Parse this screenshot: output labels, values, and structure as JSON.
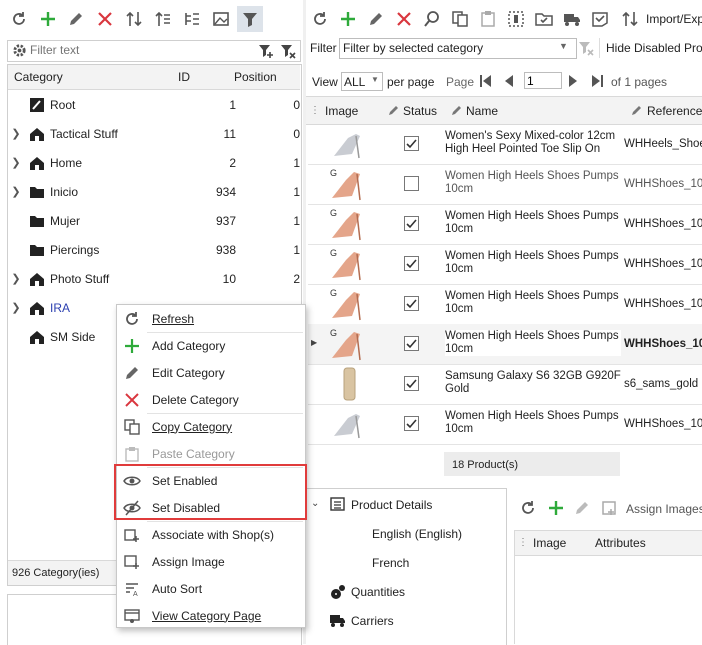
{
  "left_panel": {
    "filter_placeholder": "Filter text",
    "columns": {
      "category": "Category",
      "id": "ID",
      "position": "Position"
    },
    "tree": [
      {
        "label": "Root",
        "id": "1",
        "pos": "0"
      },
      {
        "label": "Tactical Stuff",
        "id": "11",
        "pos": "0"
      },
      {
        "label": "Home",
        "id": "2",
        "pos": "1"
      },
      {
        "label": "Inicio",
        "id": "934",
        "pos": "1"
      },
      {
        "label": "Mujer",
        "id": "937",
        "pos": "1"
      },
      {
        "label": "Piercings",
        "id": "938",
        "pos": "1"
      },
      {
        "label": "Photo Stuff",
        "id": "10",
        "pos": "2"
      },
      {
        "label": "IRA"
      },
      {
        "label": "SM Side"
      }
    ],
    "footer": "926 Category(ies)"
  },
  "right_panel": {
    "toolbar_import_label": "Import/Exp",
    "filter_label": "Filter",
    "filter_value": "Filter by selected category",
    "hide_disabled_label": "Hide Disabled Pro",
    "view_label": "View",
    "view_value": "ALL",
    "per_page_label": "per page",
    "page_label": "Page",
    "page_value": "1",
    "of_pages": "of 1 pages",
    "grid_columns": {
      "image": "Image",
      "status": "Status",
      "name": "Name",
      "reference": "Reference"
    },
    "rows": [
      {
        "name": "Women's Sexy Mixed-color 12cm High Heel Pointed Toe Slip On",
        "ref": "WHHeels_Shoe",
        "checked": true
      },
      {
        "name": "Women High Heels Shoes Pumps 10cm",
        "ref": "WHHShoes_10",
        "checked": false
      },
      {
        "name": "Women High Heels Shoes Pumps 10cm",
        "ref": "WHHShoes_10",
        "checked": true
      },
      {
        "name": "Women High Heels Shoes Pumps 10cm",
        "ref": "WHHShoes_10",
        "checked": true
      },
      {
        "name": "Women High Heels Shoes Pumps 10cm",
        "ref": "WHHShoes_10",
        "checked": true
      },
      {
        "name": "Women High Heels Shoes Pumps 10cm",
        "ref": "WHHShoes_10",
        "checked": true
      },
      {
        "name": "Samsung Galaxy S6 32GB G920F Gold",
        "ref": "s6_sams_gold",
        "checked": true
      },
      {
        "name": "Women High Heels Shoes Pumps 10cm",
        "ref": "WHHShoes_10",
        "checked": true
      }
    ],
    "product_count": "18 Product(s)",
    "details_tree": {
      "product_details": "Product Details",
      "english": "English (English)",
      "french": "French",
      "quantities": "Quantities",
      "carriers": "Carriers"
    },
    "assign_images_label": "Assign Images",
    "bottom_grid_columns": {
      "image": "Image",
      "attributes": "Attributes"
    }
  },
  "context_menu": [
    {
      "label": "Refresh",
      "icon": "refresh-icon"
    },
    {
      "label": "Add Category",
      "icon": "plus-icon"
    },
    {
      "label": "Edit Category",
      "icon": "pencil-icon"
    },
    {
      "label": "Delete Category",
      "icon": "x-icon"
    },
    {
      "label": "Copy Category",
      "icon": "copy-icon"
    },
    {
      "label": "Paste Category",
      "icon": "paste-icon"
    },
    {
      "label": "Set Enabled",
      "icon": "eye-icon"
    },
    {
      "label": "Set Disabled",
      "icon": "eye-off-icon"
    },
    {
      "label": "Associate with Shop(s)",
      "icon": "shop-icon"
    },
    {
      "label": "Assign Image",
      "icon": "image-icon"
    },
    {
      "label": "Auto Sort",
      "icon": "sort-icon"
    },
    {
      "label": "View Category Page",
      "icon": "view-page-icon"
    }
  ],
  "colors": {
    "accent_green": "#2eaa3a",
    "danger_red": "#d9363e",
    "highlight_red": "#e03b3b",
    "selected_label": "#2b3fb0"
  }
}
